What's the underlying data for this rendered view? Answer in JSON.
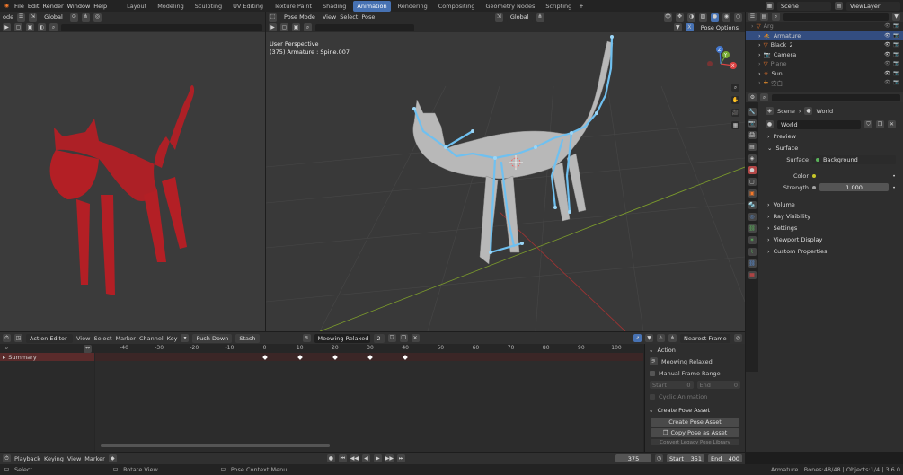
{
  "topbar": {
    "menus": [
      "File",
      "Edit",
      "Render",
      "Window",
      "Help"
    ],
    "workspaces": [
      "Layout",
      "Modeling",
      "Sculpting",
      "UV Editing",
      "Texture Paint",
      "Shading",
      "Animation",
      "Rendering",
      "Compositing",
      "Geometry Nodes",
      "Scripting"
    ],
    "active_workspace": "Animation",
    "add_tab": "+",
    "scene": "Scene",
    "view_layer": "ViewLayer"
  },
  "left_viewport": {
    "mode": "ode",
    "orientation": "Global"
  },
  "main_viewport": {
    "mode": "Pose Mode",
    "menus": [
      "View",
      "Select",
      "Pose"
    ],
    "orientation": "Global",
    "pose_options": "Pose Options",
    "overlay_title": "User Perspective",
    "overlay_subtitle": "(375) Armature : Spine.007",
    "gizmo": {
      "x": "X",
      "y": "Y",
      "z": "Z"
    }
  },
  "outliner": {
    "items": [
      {
        "label": "Arg",
        "indent": 0,
        "selected": false,
        "dim": true
      },
      {
        "label": "Armature",
        "indent": 1,
        "selected": true,
        "dim": false
      },
      {
        "label": "Black_2",
        "indent": 1,
        "selected": false,
        "dim": false
      },
      {
        "label": "Camera",
        "indent": 1,
        "selected": false,
        "dim": false
      },
      {
        "label": "Plane",
        "indent": 1,
        "selected": false,
        "dim": true
      },
      {
        "label": "Sun",
        "indent": 1,
        "selected": false,
        "dim": false
      },
      {
        "label": "空白",
        "indent": 1,
        "selected": false,
        "dim": true
      }
    ]
  },
  "properties": {
    "breadcrumb_scene": "Scene",
    "breadcrumb_world": "World",
    "world_name": "World",
    "panels": {
      "preview": "Preview",
      "surface": "Surface",
      "volume": "Volume",
      "ray_visibility": "Ray Visibility",
      "settings": "Settings",
      "viewport_display": "Viewport Display",
      "custom_properties": "Custom Properties"
    },
    "surface_label": "Surface",
    "surface_value": "Background",
    "color_label": "Color",
    "strength_label": "Strength",
    "strength_value": "1.000"
  },
  "action_editor": {
    "mode": "Action Editor",
    "menus": [
      "View",
      "Select",
      "Marker",
      "Channel",
      "Key"
    ],
    "push_down": "Push Down",
    "stash": "Stash",
    "action_name": "Meowing Relaxed",
    "users": "2",
    "snap": "Nearest Frame",
    "summary": "Summary",
    "ticks": [
      -40,
      -30,
      -20,
      -10,
      0,
      10,
      20,
      30,
      40,
      50,
      60,
      70,
      80,
      90,
      100
    ],
    "keyframes": [
      0,
      10,
      20,
      30,
      40
    ]
  },
  "sidebar": {
    "action_header": "Action",
    "action_name": "Meowing Relaxed",
    "manual_frame_range": "Manual Frame Range",
    "start_label": "Start",
    "start_value": "0",
    "end_label": "End",
    "end_value": "0",
    "cyclic": "Cyclic Animation",
    "create_pose_header": "Create Pose Asset",
    "create_pose_button": "Create Pose Asset",
    "copy_pose_button": "Copy Pose as Asset",
    "paste_pose_button": "Convert Legacy Pose Library"
  },
  "timeline": {
    "menus": [
      "Playback",
      "Keying",
      "View",
      "Marker"
    ],
    "current_frame": "375",
    "start_label": "Start",
    "start_value": "351",
    "end_label": "End",
    "end_value": "400"
  },
  "statusbar": {
    "select": "Select",
    "rotate_view": "Rotate View",
    "context_menu": "Pose Context Menu",
    "stats": "Armature | Bones:48/48 | Objects:1/4 | 3.6.0"
  },
  "colors": {
    "accent": "#4772b3",
    "cat_red": "#b31f25",
    "bone_blue": "#6fc0f0",
    "keyframe": "#ffffff"
  }
}
